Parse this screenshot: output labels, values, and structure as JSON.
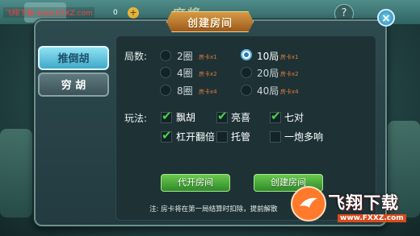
{
  "background": {
    "watermark_top": "飞翔下载 www.FXXZ.com",
    "lobby_title": "麻将",
    "coin_count": "0",
    "coin_plus": "+",
    "help_icon": "question-icon"
  },
  "dialog": {
    "title": "创建房间",
    "close_label": "×",
    "tabs": [
      {
        "label": "推倒胡",
        "active": true
      },
      {
        "label": "穷 胡",
        "active": false
      }
    ],
    "rounds": {
      "label": "局数:",
      "options": [
        {
          "text": "2圈",
          "sub": "房卡x1",
          "selected": false
        },
        {
          "text": "10局",
          "sub": "房卡x1",
          "selected": true
        },
        {
          "text": "4圈",
          "sub": "房卡x2",
          "selected": false
        },
        {
          "text": "20局",
          "sub": "房卡x2",
          "selected": false
        },
        {
          "text": "8圈",
          "sub": "房卡x4",
          "selected": false
        },
        {
          "text": "40局",
          "sub": "房卡x4",
          "selected": false
        }
      ]
    },
    "rules": {
      "label": "玩法:",
      "options": [
        {
          "text": "飘胡",
          "checked": true
        },
        {
          "text": "亮喜",
          "checked": true
        },
        {
          "text": "七对",
          "checked": true
        },
        {
          "text": "杠开翻倍",
          "checked": true
        },
        {
          "text": "托管",
          "checked": false
        },
        {
          "text": "一炮多响",
          "checked": false
        }
      ]
    },
    "buttons": {
      "proxy_open": "代开房间",
      "create": "创建房间"
    },
    "note": "注:  房卡将在第一局结算时扣除，提前解散"
  },
  "watermark": {
    "brand": "飞翔下载",
    "url": "www.FXXZ.com"
  },
  "colors": {
    "accent_green": "#4cd14a",
    "radio_selected": "#2a78b5",
    "sub_orange": "#e07a3a"
  }
}
